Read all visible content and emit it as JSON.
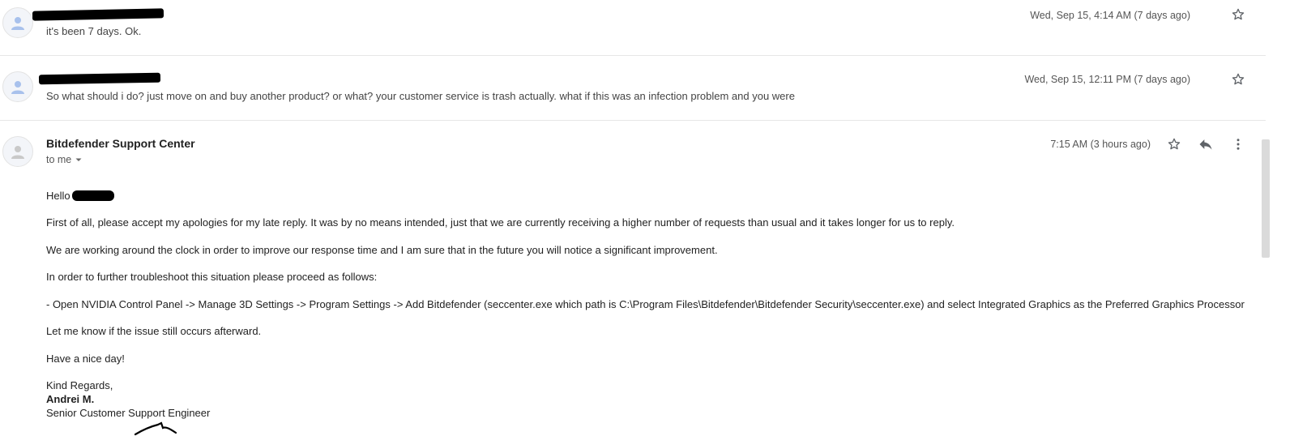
{
  "messages": [
    {
      "snippet": "it's been 7 days. Ok.",
      "date": "Wed, Sep 15, 4:14 AM (7 days ago)"
    },
    {
      "snippet": "So what should i do? just move on and buy another product? or what? your customer service is trash actually. what if this was an infection problem and you were",
      "date": "Wed, Sep 15, 12:11 PM (7 days ago)"
    }
  ],
  "open_message": {
    "sender": "Bitdefender Support Center",
    "recipient": "to me",
    "date": "7:15 AM (3 hours ago)",
    "greeting": "Hello",
    "paragraphs": [
      "First of all, please accept my apologies for my late reply. It was by no means intended, just that we are currently receiving a higher number of requests than usual and it takes longer for us to reply.",
      "We are working around the clock in order to improve our response time and I am sure that in the future you will notice a significant improvement.",
      "In order to further troubleshoot this situation please proceed as follows:",
      "- Open NVIDIA Control Panel -> Manage 3D Settings -> Program Settings -> Add Bitdefender (seccenter.exe which path is C:\\Program Files\\Bitdefender\\Bitdefender Security\\seccenter.exe) and select Integrated Graphics as the Preferred Graphics Processor",
      "Let me know if the issue still occurs afterward.",
      "Have a nice day!"
    ],
    "closing": "Kind Regards,",
    "signer_name": "Andrei M.",
    "signer_title": "Senior Customer Support Engineer"
  },
  "icons": {
    "star": "star-outline-icon",
    "reply": "reply-icon",
    "more": "more-vert-icon",
    "avatar": "person-avatar-icon"
  },
  "colors": {
    "avatar_person_blue": "#a8c1ec",
    "avatar_person_gray": "#c9c9c9",
    "icon_gray": "#5f6368",
    "redaction": "#000000"
  }
}
